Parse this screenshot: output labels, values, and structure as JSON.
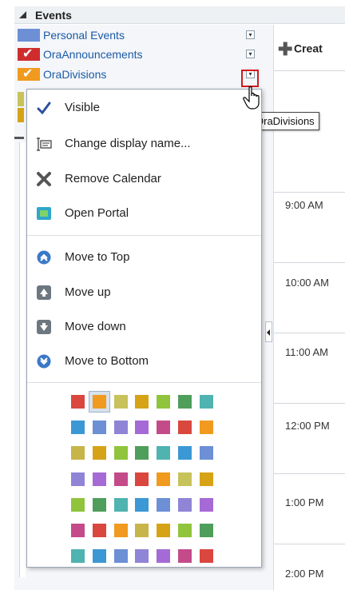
{
  "header": {
    "title": "Events"
  },
  "calendars": [
    {
      "label": "Personal Events",
      "color": "#6c8fd6",
      "checked": false
    },
    {
      "label": "OraAnnouncements",
      "color": "#cf2d2d",
      "checked": true
    },
    {
      "label": "OraDivisions",
      "color": "#f09a1f",
      "checked": true
    }
  ],
  "toolbar": {
    "create_label": "Creat"
  },
  "tooltip": {
    "text": "OraDivisions"
  },
  "menu": {
    "items": [
      {
        "label": "Visible",
        "icon": "checkmark-icon"
      },
      {
        "label": "Change display name...",
        "icon": "rename-icon"
      },
      {
        "label": "Remove Calendar",
        "icon": "x-icon"
      },
      {
        "label": "Open Portal",
        "icon": "portal-icon"
      },
      {
        "label": "Move to Top",
        "icon": "move-to-top-icon"
      },
      {
        "label": "Move up",
        "icon": "arrow-up-icon"
      },
      {
        "label": "Move down",
        "icon": "arrow-down-icon"
      },
      {
        "label": "Move to Bottom",
        "icon": "move-to-bottom-icon"
      }
    ],
    "swatch_rows": [
      [
        "#d9473f",
        "#f09a1f",
        "#c7c35a",
        "#d6a316",
        "#8fc43c",
        "#4f9e5b",
        "#4fb3b0"
      ],
      [
        "#3b98d4",
        "#6c8fd6",
        "#8f84d6",
        "#a66ad6",
        "#c44b8a",
        "#d9473f",
        "#f09a1f"
      ],
      [
        "#c7b54a",
        "#d6a316",
        "#8fc43c",
        "#4f9e5b",
        "#4fb3b0",
        "#3b98d4",
        "#6c8fd6"
      ],
      [
        "#8f84d6",
        "#a66ad6",
        "#c44b8a",
        "#d9473f",
        "#f09a1f",
        "#c7c35a",
        "#d6a316"
      ],
      [
        "#8fc43c",
        "#4f9e5b",
        "#4fb3b0",
        "#3b98d4",
        "#6c8fd6",
        "#8f84d6",
        "#a66ad6"
      ],
      [
        "#c44b8a",
        "#d9473f",
        "#f09a1f",
        "#c7b54a",
        "#d6a316",
        "#8fc43c",
        "#4f9e5b"
      ],
      [
        "#4fb3b0",
        "#3b98d4",
        "#6c8fd6",
        "#8f84d6",
        "#a66ad6",
        "#c44b8a",
        "#d9473f"
      ]
    ],
    "selected_swatch": "#f09a1f"
  },
  "time_slots": [
    "9:00 AM",
    "10:00 AM",
    "11:00 AM",
    "12:00 PM",
    "1:00 PM",
    "2:00 PM"
  ]
}
